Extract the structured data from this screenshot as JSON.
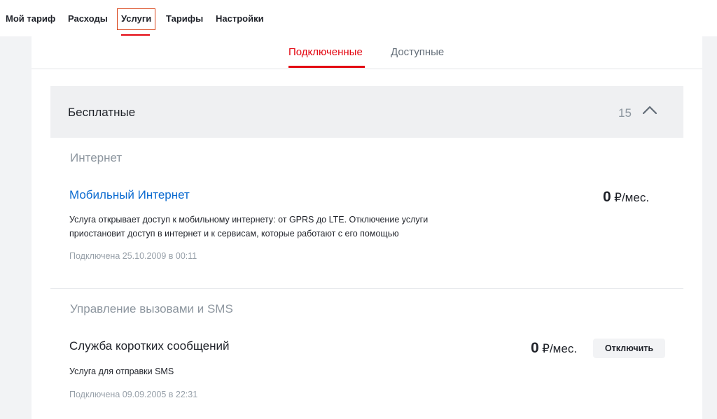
{
  "topnav": {
    "items": [
      {
        "label": "Мой тариф"
      },
      {
        "label": "Расходы"
      },
      {
        "label": "Услуги",
        "active": true
      },
      {
        "label": "Тарифы"
      },
      {
        "label": "Настройки"
      }
    ]
  },
  "subtabs": {
    "connected": "Подключенные",
    "available": "Доступные"
  },
  "group": {
    "title": "Бесплатные",
    "count": "15"
  },
  "sections": [
    {
      "title": "Интернет",
      "service": {
        "name": "Мобильный Интернет",
        "description": "Услуга открывает доступ к мобильному интернету: от GPRS до LTE. Отключение услуги приостановит доступ в интернет и к сервисам, которые работают с его помощью",
        "date": "Подключена 25.10.2009 в 00:11",
        "price_amount": "0",
        "price_unit": "₽/мес."
      }
    },
    {
      "title": "Управление вызовами и SMS",
      "service": {
        "name": "Служба коротких сообщений",
        "description": "Услуга для отправки SMS",
        "date": "Подключена 09.09.2005 в 22:31",
        "price_amount": "0",
        "price_unit": "₽/мес.",
        "action_label": "Отключить"
      }
    }
  ],
  "colors": {
    "accent": "#e30611",
    "link": "#0a6ad0",
    "highlight_box": "#d9451a"
  }
}
